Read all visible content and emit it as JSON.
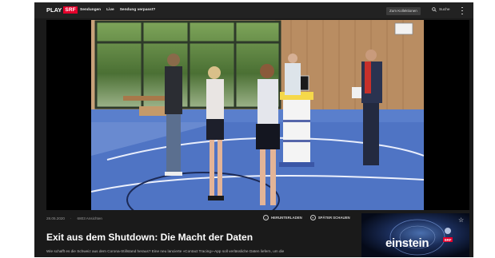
{
  "header": {
    "logo_text": "PLAY",
    "logo_badge": "SRF",
    "nav": [
      "Sendungen",
      "Live",
      "Sendung verpasst?"
    ],
    "collection_button": "Zum Kollektionen",
    "search_label": "Suche",
    "search_icon": "search-icon",
    "menu_icon": "more-vertical-icon"
  },
  "episode": {
    "date": "28.05.2020",
    "views": "6803 Ansichten",
    "actions": [
      {
        "label": "HERUNTERLADEN",
        "icon": "download-icon"
      },
      {
        "label": "SPÄTER SCHAUEN",
        "icon": "watch-later-icon"
      }
    ],
    "title": "Exit aus dem Shutdown: Die Macht der Daten",
    "description": "Wie schafft es die Schweiz aus dem Corona-Stillstand heraus? Eine neu lancierte «Contact Tracing»-App soll verlässliche Daten liefern, um die"
  },
  "show_card": {
    "name": "einstein",
    "badge": "SRF",
    "favorite_icon": "star-icon"
  },
  "colors": {
    "brand_red": "#e4002b",
    "background": "#1a1a1a",
    "header": "#222222",
    "gym_floor": "#4f74c4"
  }
}
